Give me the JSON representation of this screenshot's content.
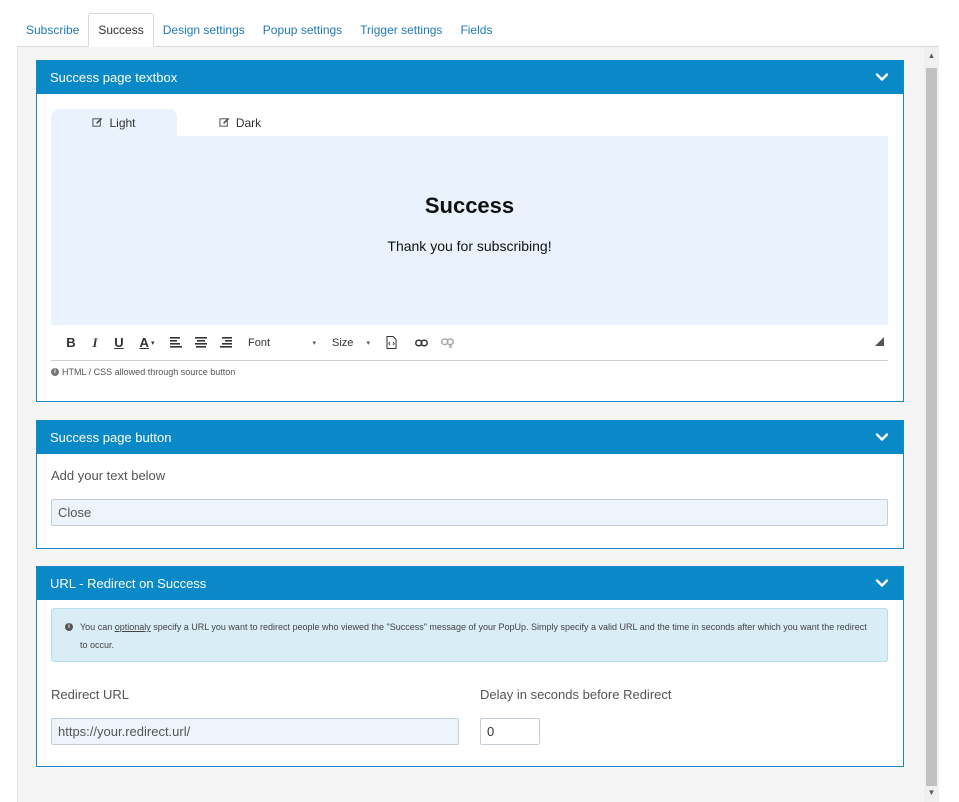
{
  "tabs": [
    {
      "label": "Subscribe",
      "active": false
    },
    {
      "label": "Success",
      "active": true
    },
    {
      "label": "Design settings",
      "active": false
    },
    {
      "label": "Popup settings",
      "active": false
    },
    {
      "label": "Trigger settings",
      "active": false
    },
    {
      "label": "Fields",
      "active": false
    }
  ],
  "panel_textbox": {
    "title": "Success page textbox",
    "editor_tabs": [
      {
        "label": "Light",
        "icon": "edit-icon",
        "active": true
      },
      {
        "label": "Dark",
        "icon": "edit-icon",
        "active": false
      }
    ],
    "content_heading": "Success",
    "content_text": "Thank you for subscribing!",
    "toolbar": {
      "bold": "B",
      "italic": "I",
      "underline": "U",
      "font_color": "A",
      "font_label": "Font",
      "size_label": "Size"
    },
    "helper_text": "HTML / CSS allowed through source button"
  },
  "panel_button": {
    "title": "Success page button",
    "label": "Add your text below",
    "placeholder": "Close"
  },
  "panel_redirect": {
    "title": "URL - Redirect on Success",
    "info_before": "You can ",
    "info_emphasis": "optionaly",
    "info_after": " specify a URL you want to redirect people who viewed the \"Success\" message of your PopUp. Simply specify a valid URL and the time in seconds after which you want the redirect to occur.",
    "url_label": "Redirect URL",
    "url_placeholder": "https://your.redirect.url/",
    "delay_label": "Delay in seconds before Redirect",
    "delay_value": "0"
  },
  "colors": {
    "panel_header": "#0a89c9",
    "link": "#1f7ab8",
    "editor_bg": "#eaf3fd",
    "info_bg": "#d8edf5"
  }
}
